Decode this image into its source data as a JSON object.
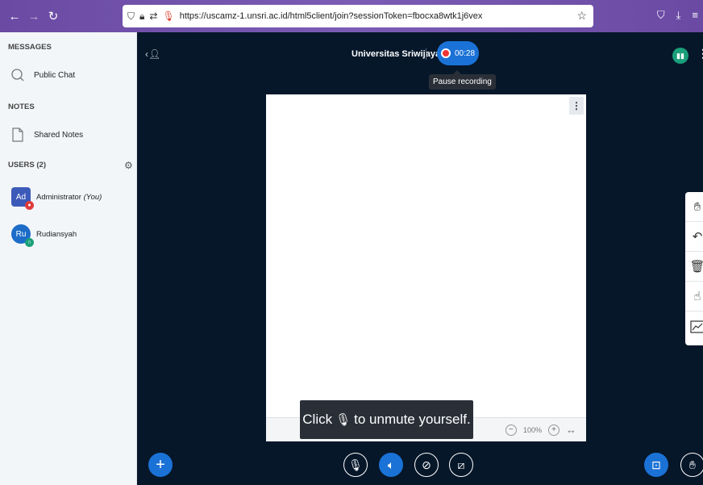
{
  "browser": {
    "url": "https://uscamz-1.unsri.ac.id/html5client/join?sessionToken=fbocxa8wtk1j6vex"
  },
  "sidebar": {
    "messages_title": "MESSAGES",
    "public_chat": "Public Chat",
    "notes_title": "NOTES",
    "shared_notes": "Shared Notes",
    "users_title": "USERS (2)",
    "users": [
      {
        "initials": "Ad",
        "name": "Administrator",
        "tag": "(You)"
      },
      {
        "initials": "Ru",
        "name": "Rudiansyah",
        "tag": ""
      }
    ]
  },
  "main": {
    "meeting_name": "Universitas Sriwijaya",
    "recording_time": "00:28",
    "tooltip": "Pause recording",
    "zoom_level": "100%",
    "toast_before": "Click",
    "toast_after": "to unmute yourself."
  },
  "colors": {
    "accent": "#1b72d6",
    "background": "#06172a",
    "sidebar": "#f3f6f9"
  }
}
